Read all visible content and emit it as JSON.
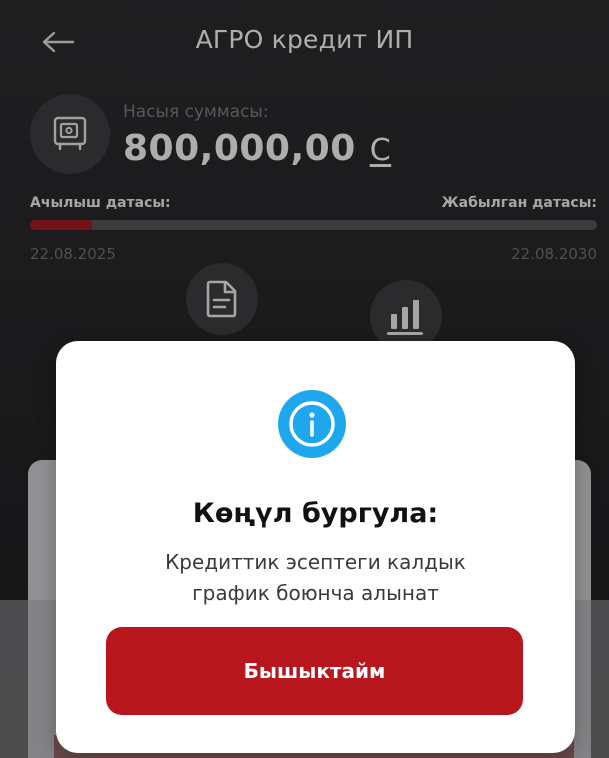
{
  "header": {
    "title": "АГРО кредит ИП",
    "back_icon": "arrow-left-icon"
  },
  "loan": {
    "amount_label": "Насыя суммасы:",
    "amount_value": "800,000,00",
    "currency_symbol": "С",
    "open_date_label": "Ачылыш датасы:",
    "close_date_label": "Жабылган датасы:",
    "open_date": "22.08.2025",
    "close_date": "22.08.2030",
    "progress_fraction": 0.11
  },
  "actions": {
    "document_icon": "document-icon",
    "chart_icon": "bar-chart-icon"
  },
  "dialog": {
    "icon": "info-icon",
    "title": "Көңүл бургула:",
    "message_line1": "Кредиттик эсептеги калдык",
    "message_line2": "график боюнча алынат",
    "confirm_label": "Бышыктайм"
  },
  "colors": {
    "accent_red": "#b8161d",
    "progress_red": "#9e1c22",
    "info_blue": "#1ea7ec"
  }
}
